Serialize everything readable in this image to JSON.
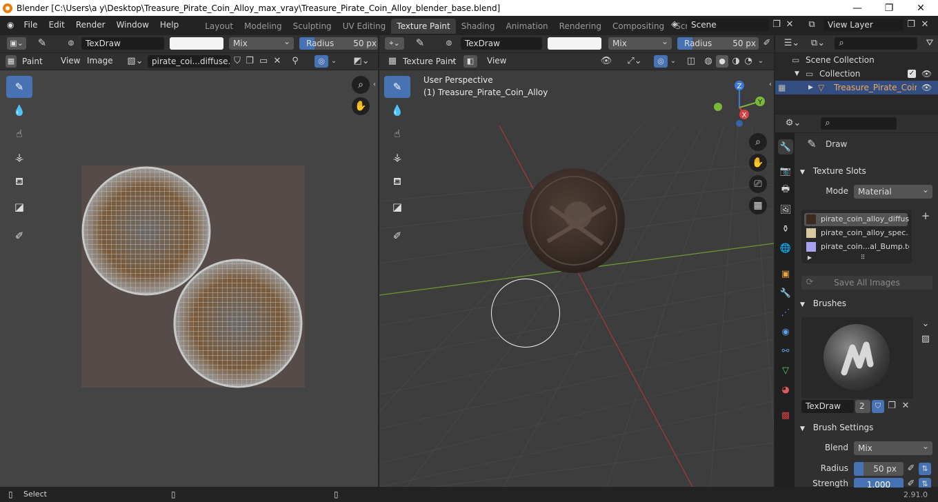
{
  "window": {
    "title": "Blender [C:\\Users\\a y\\Desktop\\Treasure_Pirate_Coin_Alloy_max_vray\\Treasure_Pirate_Coin_Alloy_blender_base.blend]",
    "minimize": "—",
    "maximize": "❐",
    "close": "✕"
  },
  "menus": [
    "File",
    "Edit",
    "Render",
    "Window",
    "Help"
  ],
  "workspaces": [
    "Layout",
    "Modeling",
    "Sculpting",
    "UV Editing",
    "Texture Paint",
    "Shading",
    "Animation",
    "Rendering",
    "Compositing",
    "Scripting"
  ],
  "active_workspace": "Texture Paint",
  "add_workspace": "+",
  "scene": {
    "label": "Scene",
    "view_layer": "View Layer"
  },
  "image_editor": {
    "brush_name": "TexDraw",
    "blend": "Mix",
    "radius_label": "Radius",
    "radius_value": "50 px",
    "mode": "Paint",
    "menu_view": "View",
    "menu_image": "Image",
    "image_name": "pirate_coi...diffuse.png"
  },
  "viewport": {
    "brush_name": "TexDraw",
    "blend": "Mix",
    "radius_label": "Radius",
    "radius_value": "50 px",
    "mode": "Texture Paint",
    "menu_view": "View",
    "overlay_line1": "User Perspective",
    "overlay_line2": "(1) Treasure_Pirate_Coin_Alloy",
    "gizmo": {
      "z": "Z",
      "y": "Y",
      "x": "X"
    }
  },
  "outliner": {
    "scene_collection": "Scene Collection",
    "collection": "Collection",
    "object": "Treasure_Pirate_Coir"
  },
  "properties": {
    "tool_name": "Draw",
    "texture_slots_title": "Texture Slots",
    "mode_label": "Mode",
    "mode_value": "Material",
    "slots": [
      "pirate_coin_alloy_diffus...",
      "pirate_coin_alloy_spec...",
      "pirate_coin...al_Bump.tga"
    ],
    "save_all": "Save All Images",
    "brushes_title": "Brushes",
    "brush_name": "TexDraw",
    "brush_users": "2",
    "brush_settings_title": "Brush Settings",
    "blend_label": "Blend",
    "blend_value": "Mix",
    "radius_label": "Radius",
    "radius_value": "50 px",
    "strength_label": "Strength",
    "strength_value": "1.000"
  },
  "statusbar": {
    "select": "Select",
    "version": "2.91.0"
  },
  "colors": {
    "accent": "#4772b3",
    "bg": "#303030",
    "viewport": "#3d3d3d",
    "x_axis": "#c83c3c",
    "y_axis": "#7ab83a"
  }
}
